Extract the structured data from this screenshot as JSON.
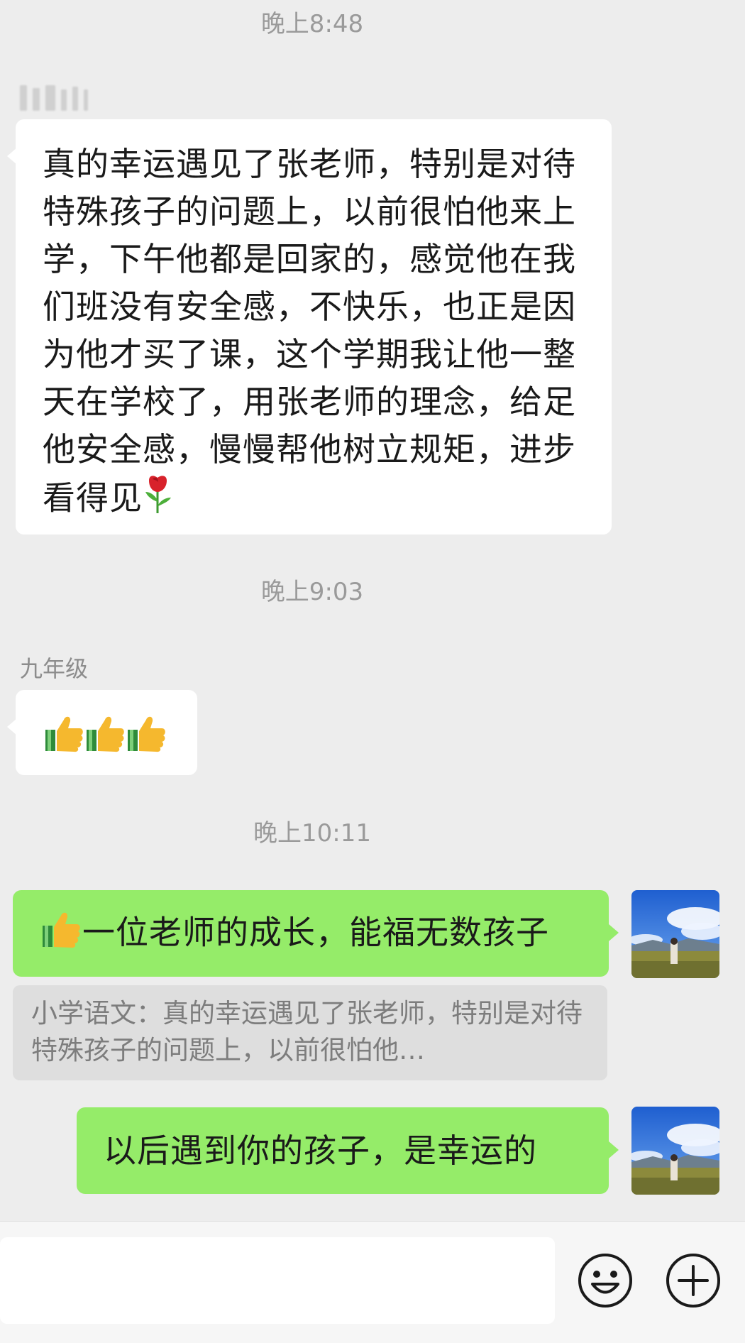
{
  "chat": {
    "timestamps": [
      "晚上8:48",
      "晚上9:03",
      "晚上10:11"
    ],
    "messages": [
      {
        "side": "left",
        "text": "真的幸运遇见了张老师，特别是对待特殊孩子的问题上，以前很怕他来上学，下午他都是回家的，感觉他在我们班没有安全感，不快乐，也正是因为他才买了课，这个学期我让他一整天在学校了，用张老师的理念，给足他安全感，慢慢帮他树立规矩，进步看得见",
        "emoji": "rose-icon"
      },
      {
        "side": "left",
        "sender": "九年级",
        "emoji": "thumbs-up-icon x3"
      },
      {
        "side": "right",
        "text": "一位老师的成长，能福无数孩子",
        "emoji": "thumbs-up-icon",
        "quote": "小学语文：真的幸运遇见了张老师，特别是对待特殊孩子的问题上，以前很怕他…"
      },
      {
        "side": "right",
        "text": "以后遇到你的孩子，是幸运的"
      }
    ]
  },
  "input_bar": {
    "value": "",
    "emoji_icon": "smiley-icon",
    "more_icon": "plus-circle-icon"
  },
  "colors": {
    "background": "#ededed",
    "left_bubble": "#ffffff",
    "right_bubble": "#95ec69",
    "quote_bg": "#dedede",
    "timestamp": "#9a9a9a"
  }
}
